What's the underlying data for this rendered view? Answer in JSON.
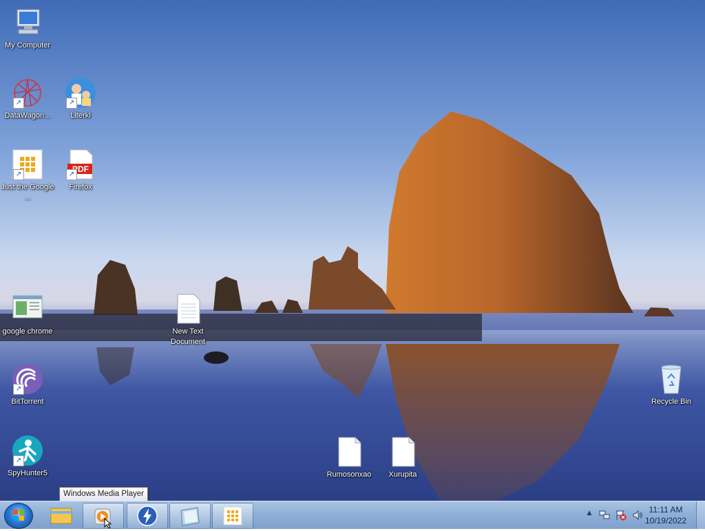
{
  "desktop": {
    "icons": {
      "my_computer": "My Computer",
      "datawagon": "DataWagon...",
      "literki": "Literki",
      "just_google": "Just the Google ...",
      "firefox": "Firefox",
      "google_chrome": "google chrome",
      "new_text_document": "New Text Document",
      "bittorrent": "BitTorrent",
      "recycle_bin": "Recycle Bin",
      "spyhunter": "SpyHunter5",
      "rumosonxao": "Rumosonxao",
      "xurupita": "Xurupita"
    },
    "pdf_badge": "PDF"
  },
  "tooltip": "Windows Media Player",
  "taskbar": {
    "pinned": [
      "windows-explorer-icon",
      "windows-media-player-icon",
      "thunderbolt-app-icon",
      "notepad-icon",
      "grid-app-icon"
    ],
    "clock": {
      "time": "11:11 AM",
      "date": "10/19/2022"
    }
  },
  "colors": {
    "taskbar": "#8fb0d8",
    "sky_top": "#3f6bb7",
    "rock": "#b8662a"
  }
}
